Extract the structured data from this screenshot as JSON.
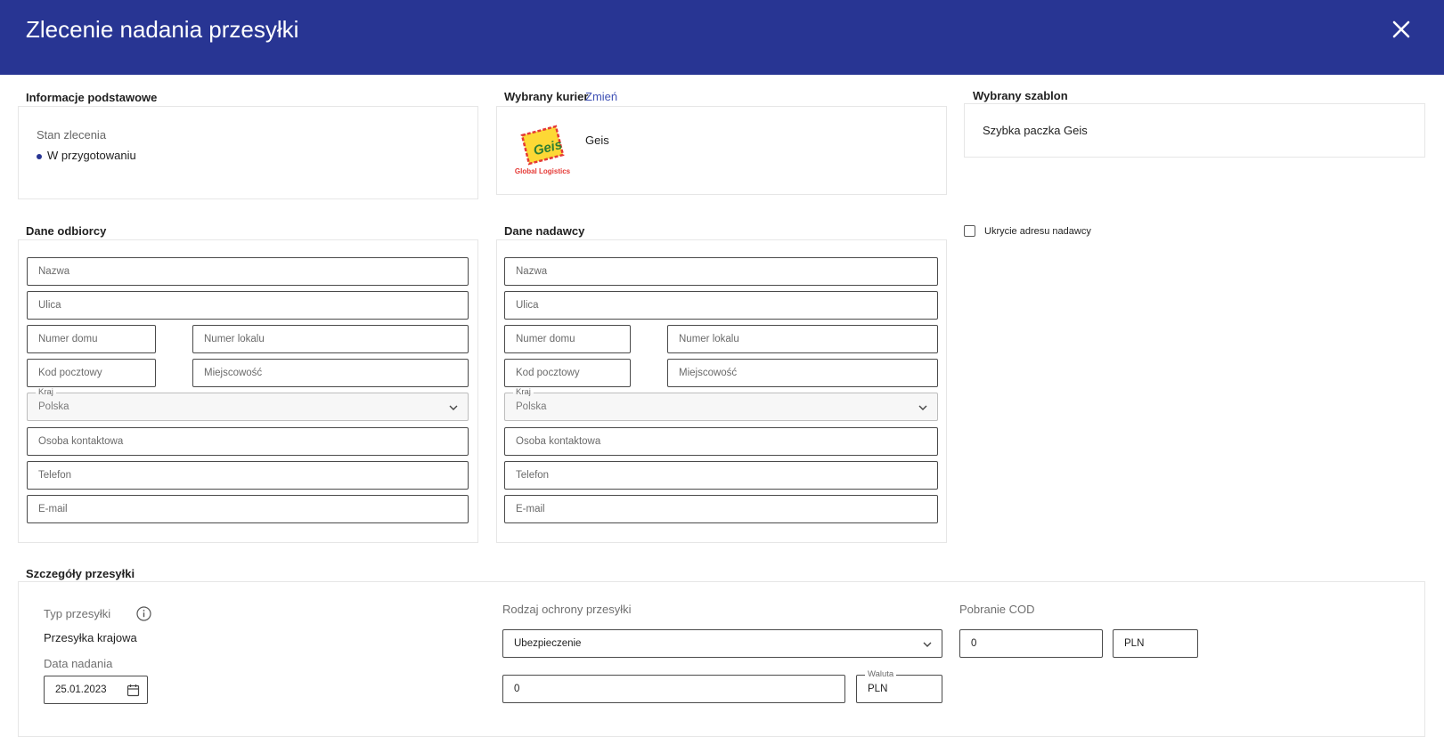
{
  "header": {
    "title": "Zlecenie nadania przesyłki"
  },
  "basic_info": {
    "title": "Informacje podstawowe",
    "status_label": "Stan zlecenia",
    "status_value": "W przygotowaniu"
  },
  "courier": {
    "title": "Wybrany kurier",
    "change_link": "Zmień",
    "name": "Geis",
    "logo_text": "Geis",
    "logo_subtext": "Global Logistics"
  },
  "template": {
    "title": "Wybrany szablon",
    "value": "Szybka paczka Geis"
  },
  "recipient": {
    "title": "Dane odbiorcy",
    "name_placeholder": "Nazwa",
    "street_placeholder": "Ulica",
    "house_placeholder": "Numer domu",
    "flat_placeholder": "Numer lokalu",
    "postal_placeholder": "Kod pocztowy",
    "city_placeholder": "Miejscowość",
    "country_label": "Kraj",
    "country_value": "Polska",
    "contact_placeholder": "Osoba kontaktowa",
    "phone_placeholder": "Telefon",
    "email_placeholder": "E-mail"
  },
  "sender": {
    "title": "Dane nadawcy",
    "name_placeholder": "Nazwa",
    "street_placeholder": "Ulica",
    "house_placeholder": "Numer domu",
    "flat_placeholder": "Numer lokalu",
    "postal_placeholder": "Kod pocztowy",
    "city_placeholder": "Miejscowość",
    "country_label": "Kraj",
    "country_value": "Polska",
    "contact_placeholder": "Osoba kontaktowa",
    "phone_placeholder": "Telefon",
    "email_placeholder": "E-mail"
  },
  "hide_sender": {
    "label": "Ukrycie adresu nadawcy",
    "checked": false
  },
  "details": {
    "title": "Szczegóły przesyłki",
    "type_label": "Typ przesyłki",
    "type_value": "Przesyłka krajowa",
    "date_label": "Data nadania",
    "date_value": "25.01.2023",
    "protection_label": "Rodzaj ochrony przesyłki",
    "protection_value": "Ubezpieczenie",
    "protection_amount": "0",
    "currency_label": "Waluta",
    "currency_value": "PLN",
    "cod_label": "Pobranie COD",
    "cod_amount": "0",
    "cod_currency": "PLN"
  },
  "colors": {
    "header_bg": "#283593",
    "link": "#3f51b5",
    "logo_red": "#e53935",
    "logo_yellow": "#fdd835"
  },
  "icons": [
    "close-icon",
    "chevron-down-icon",
    "info-icon",
    "calendar-icon"
  ]
}
